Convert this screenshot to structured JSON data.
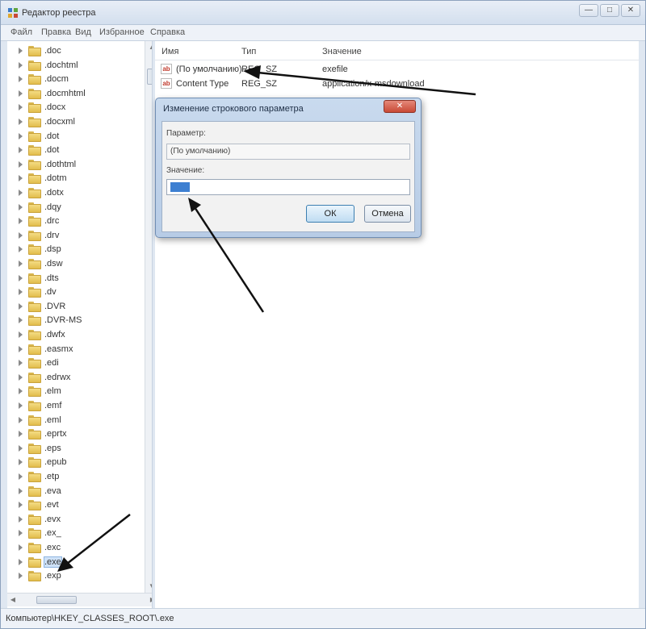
{
  "window": {
    "title": "Редактор реестра",
    "controls": {
      "minimize": "—",
      "maximize": "□",
      "close": "✕"
    }
  },
  "menu": [
    "Файл",
    "Правка",
    "Вид",
    "Избранное",
    "Справка"
  ],
  "tree": {
    "items": [
      ".doc",
      ".dochtml",
      ".docm",
      ".docmhtml",
      ".docx",
      ".docxml",
      ".dot",
      ".dot",
      ".dothtml",
      ".dotm",
      ".dotx",
      ".dqy",
      ".drc",
      ".drv",
      ".dsp",
      ".dsw",
      ".dts",
      ".dv",
      ".DVR",
      ".DVR-MS",
      ".dwfx",
      ".easmx",
      ".edi",
      ".edrwx",
      ".elm",
      ".emf",
      ".eml",
      ".eprtx",
      ".eps",
      ".epub",
      ".etp",
      ".eva",
      ".evt",
      ".evx",
      ".ex_",
      ".exc",
      ".exe",
      ".exp"
    ],
    "selected_index": 36
  },
  "values": {
    "columns": [
      "Имя",
      "Тип",
      "Значение"
    ],
    "rows": [
      {
        "icon": "ab",
        "name": "(По умолчанию)",
        "type": "REG_SZ",
        "value": "exefile"
      },
      {
        "icon": "ab",
        "name": "Content Type",
        "type": "REG_SZ",
        "value": "application/x-msdownload"
      }
    ]
  },
  "dialog": {
    "title": "Изменение строкового параметра",
    "close": "✕",
    "param_label": "Параметр:",
    "param_value": "(По умолчанию)",
    "value_label": "Значение:",
    "ok": "ОК",
    "cancel": "Отмена"
  },
  "status": "Компьютер\\HKEY_CLASSES_ROOT\\.exe",
  "colors": {
    "arrow": "#111111",
    "selection": "#3d7fd1",
    "close_button": "#c94a36"
  }
}
